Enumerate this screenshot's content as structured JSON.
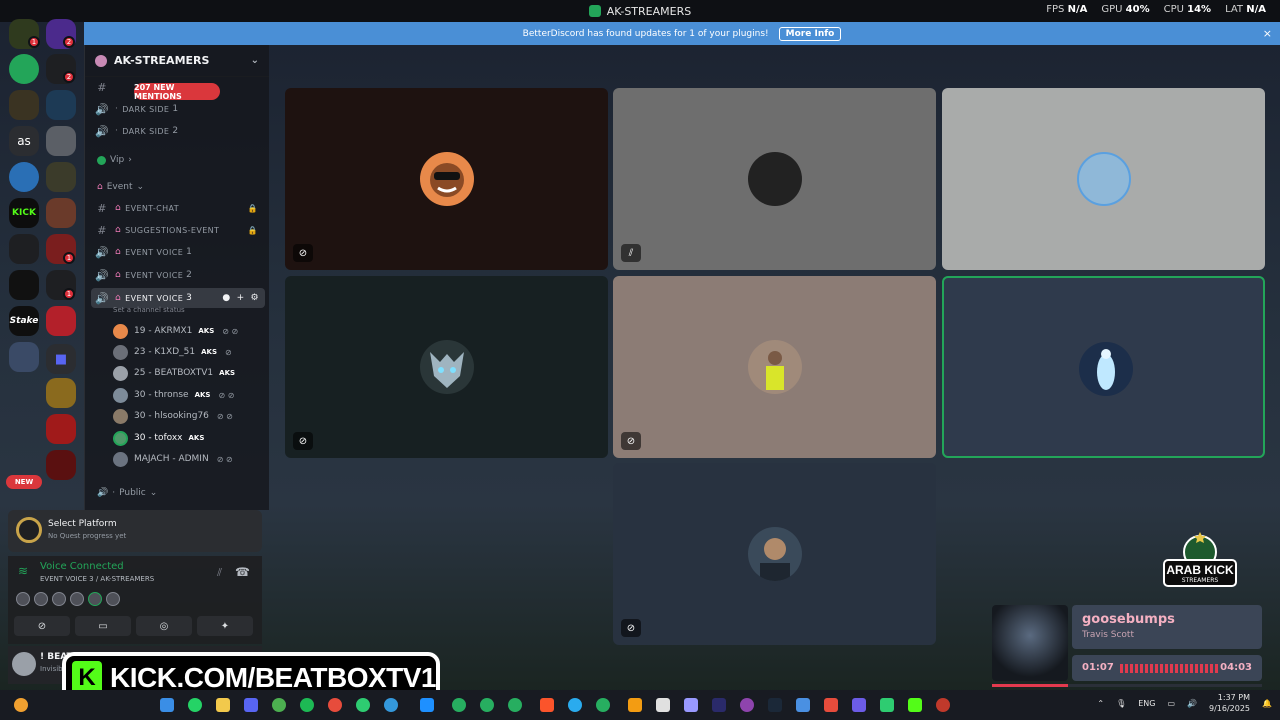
{
  "window": {
    "title": "AK-STREAMERS"
  },
  "perf": {
    "fps_label": "FPS",
    "fps": "N/A",
    "gpu_label": "GPU",
    "gpu": "40%",
    "cpu_label": "CPU",
    "cpu": "14%",
    "lat_label": "LAT",
    "lat": "N/A"
  },
  "banner": {
    "text": "BetterDiscord has found updates for 1 of your plugins!",
    "button": "More Info",
    "close": "×"
  },
  "server": {
    "name": "AK-STREAMERS"
  },
  "mentions": "207 NEW MENTIONS",
  "channels": {
    "dark_side_1": {
      "name": "DARK SIDE",
      "num": "1"
    },
    "dark_side_2": {
      "name": "DARK SIDE",
      "num": "2"
    },
    "vip": "Vip",
    "event_cat": "Event",
    "event_chat": "EVENT-CHAT",
    "suggestions": "SUGGESTIONS-EVENT",
    "ev1": {
      "name": "EVENT VOICE",
      "num": "1"
    },
    "ev2": {
      "name": "EVENT VOICE",
      "num": "2"
    },
    "ev3": {
      "name": "EVENT VOICE",
      "num": "3"
    },
    "status_hint": "Set a channel status",
    "public": "Public"
  },
  "voice_users": [
    {
      "name": "19 - AKRMX1",
      "tag": "AKS",
      "color": "#e8894a"
    },
    {
      "name": "23 - K1XD_51",
      "tag": "AKS",
      "color": "#6b6f78"
    },
    {
      "name": "25 - BEATBOXTV1",
      "tag": "AKS",
      "color": "#9aa0a8"
    },
    {
      "name": "30 - thronse",
      "tag": "AKS",
      "color": "#7d8b99"
    },
    {
      "name": "30 - hlsooking76",
      "tag": "",
      "color": "#8a7a68"
    },
    {
      "name": "30 - tofoxx",
      "tag": "AKS",
      "color": "#4f9a6a"
    },
    {
      "name": "MAJACH - ADMIN",
      "tag": "",
      "color": "#6b7380"
    }
  ],
  "quest": {
    "title": "Select Platform",
    "sub": "No Quest progress yet"
  },
  "voice_panel": {
    "title": "Voice Connected",
    "sub": "EVENT VOICE 3 / AK-STREAMERS"
  },
  "user_panel": {
    "name": "! BEAT",
    "status": "Invisib"
  },
  "rail": {
    "as_label": "as",
    "new_label": "NEW",
    "stake": "Stake"
  },
  "music": {
    "title": "goosebumps",
    "artist": "Travis Scott",
    "current": "01:07",
    "duration": "04:03",
    "progress": 0.28
  },
  "arab_kick": {
    "line1": "ARAB KICK",
    "line2": "STREAMERS"
  },
  "kick": {
    "logo": "K",
    "url": "KICK.COM/BEATBOXTV1"
  },
  "taskbar": {
    "lang": "ENG",
    "time": "1:37 PM",
    "date": "9/16/2025"
  },
  "colors": {
    "accent_green": "#23a559",
    "banner_blue": "#4a8fd6",
    "mention_red": "#da373c",
    "kick_green": "#53fc18"
  }
}
